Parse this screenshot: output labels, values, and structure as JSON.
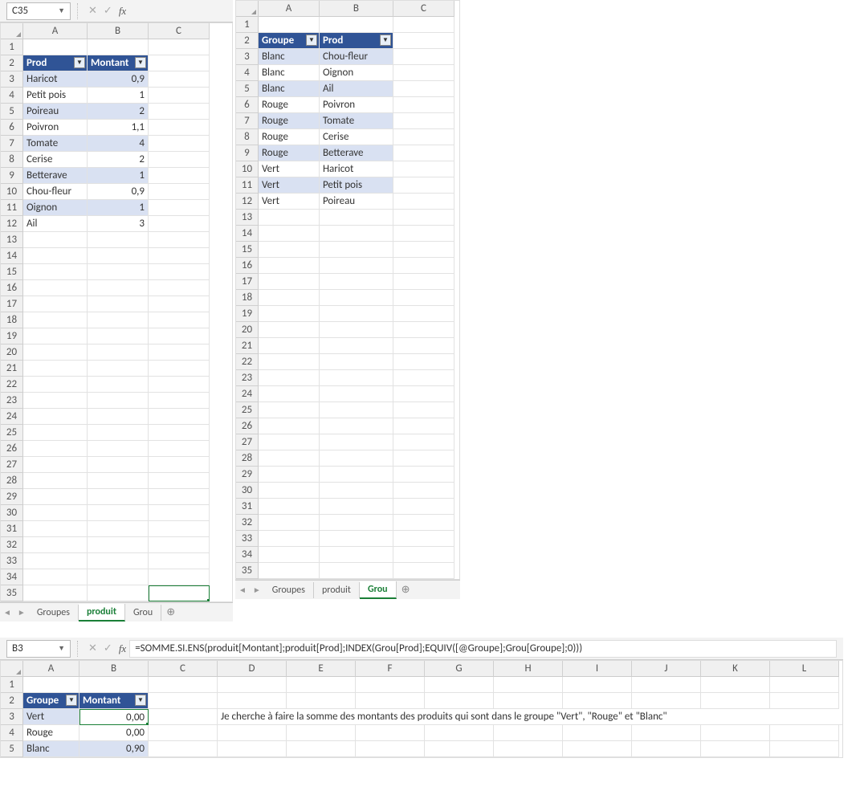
{
  "panel1": {
    "namebox": "C35",
    "cols": [
      "A",
      "B",
      "C"
    ],
    "header": {
      "prod": "Prod",
      "montant": "Montant"
    },
    "rows": [
      {
        "n": 1,
        "a": "",
        "b": ""
      },
      {
        "n": 2,
        "th": true
      },
      {
        "n": 3,
        "a": "Haricot",
        "b": "0,9",
        "band": true
      },
      {
        "n": 4,
        "a": "Petit pois",
        "b": "1"
      },
      {
        "n": 5,
        "a": "Poireau",
        "b": "2",
        "band": true
      },
      {
        "n": 6,
        "a": "Poivron",
        "b": "1,1"
      },
      {
        "n": 7,
        "a": "Tomate",
        "b": "4",
        "band": true
      },
      {
        "n": 8,
        "a": "Cerise",
        "b": "2"
      },
      {
        "n": 9,
        "a": "Betterave",
        "b": "1",
        "band": true
      },
      {
        "n": 10,
        "a": "Chou-fleur",
        "b": "0,9"
      },
      {
        "n": 11,
        "a": "Oignon",
        "b": "1",
        "band": true
      },
      {
        "n": 12,
        "a": "Ail",
        "b": "3"
      },
      {
        "n": 13
      },
      {
        "n": 14
      },
      {
        "n": 15
      },
      {
        "n": 16
      },
      {
        "n": 17
      },
      {
        "n": 18
      },
      {
        "n": 19
      },
      {
        "n": 20
      },
      {
        "n": 21
      },
      {
        "n": 22
      },
      {
        "n": 23
      },
      {
        "n": 24
      },
      {
        "n": 25
      },
      {
        "n": 26
      },
      {
        "n": 27
      },
      {
        "n": 28
      },
      {
        "n": 29
      },
      {
        "n": 30
      },
      {
        "n": 31
      },
      {
        "n": 32
      },
      {
        "n": 33
      },
      {
        "n": 34
      },
      {
        "n": 35,
        "sel": "C"
      }
    ],
    "tabs": [
      "Groupes",
      "produit",
      "Grou"
    ],
    "active_tab": "produit"
  },
  "panel2": {
    "cols": [
      "A",
      "B",
      "C"
    ],
    "header": {
      "groupe": "Groupe",
      "prod": "Prod"
    },
    "rows": [
      {
        "n": 1,
        "a": "",
        "b": ""
      },
      {
        "n": 2,
        "th": true
      },
      {
        "n": 3,
        "a": "Blanc",
        "b": "Chou-fleur",
        "band": true
      },
      {
        "n": 4,
        "a": "Blanc",
        "b": "Oignon"
      },
      {
        "n": 5,
        "a": "Blanc",
        "b": "Ail",
        "band": true
      },
      {
        "n": 6,
        "a": "Rouge",
        "b": "Poivron"
      },
      {
        "n": 7,
        "a": "Rouge",
        "b": "Tomate",
        "band": true
      },
      {
        "n": 8,
        "a": "Rouge",
        "b": "Cerise"
      },
      {
        "n": 9,
        "a": "Rouge",
        "b": "Betterave",
        "band": true
      },
      {
        "n": 10,
        "a": "Vert",
        "b": "Haricot"
      },
      {
        "n": 11,
        "a": "Vert",
        "b": "Petit pois",
        "band": true
      },
      {
        "n": 12,
        "a": "Vert",
        "b": "Poireau"
      },
      {
        "n": 13
      },
      {
        "n": 14
      },
      {
        "n": 15
      },
      {
        "n": 16
      },
      {
        "n": 17
      },
      {
        "n": 18
      },
      {
        "n": 19
      },
      {
        "n": 20
      },
      {
        "n": 21
      },
      {
        "n": 22
      },
      {
        "n": 23
      },
      {
        "n": 24
      },
      {
        "n": 25
      },
      {
        "n": 26
      },
      {
        "n": 27
      },
      {
        "n": 28
      },
      {
        "n": 29
      },
      {
        "n": 30
      },
      {
        "n": 31
      },
      {
        "n": 32
      },
      {
        "n": 33
      },
      {
        "n": 34
      },
      {
        "n": 35
      }
    ],
    "tabs": [
      "Groupes",
      "produit",
      "Grou"
    ],
    "active_tab": "Grou"
  },
  "panel3": {
    "namebox": "B3",
    "formula": "=SOMME.SI.ENS(produit[Montant];produit[Prod];INDEX(Grou[Prod];EQUIV([@Groupe];Grou[Groupe];0)))",
    "cols": [
      "A",
      "B",
      "C",
      "D",
      "E",
      "F",
      "G",
      "H",
      "I",
      "J",
      "K",
      "L"
    ],
    "header": {
      "groupe": "Groupe",
      "montant": "Montant"
    },
    "note": "Je cherche à faire la somme des montants des produits qui sont dans le groupe \"Vert\", \"Rouge\" et \"Blanc\"",
    "rows": [
      {
        "n": 1
      },
      {
        "n": 2,
        "th": true
      },
      {
        "n": 3,
        "a": "Vert",
        "b": "0,00",
        "band": true,
        "sel": true,
        "note": true
      },
      {
        "n": 4,
        "a": "Rouge",
        "b": "0,00"
      },
      {
        "n": 5,
        "a": "Blanc",
        "b": "0,90",
        "band": true
      }
    ]
  }
}
